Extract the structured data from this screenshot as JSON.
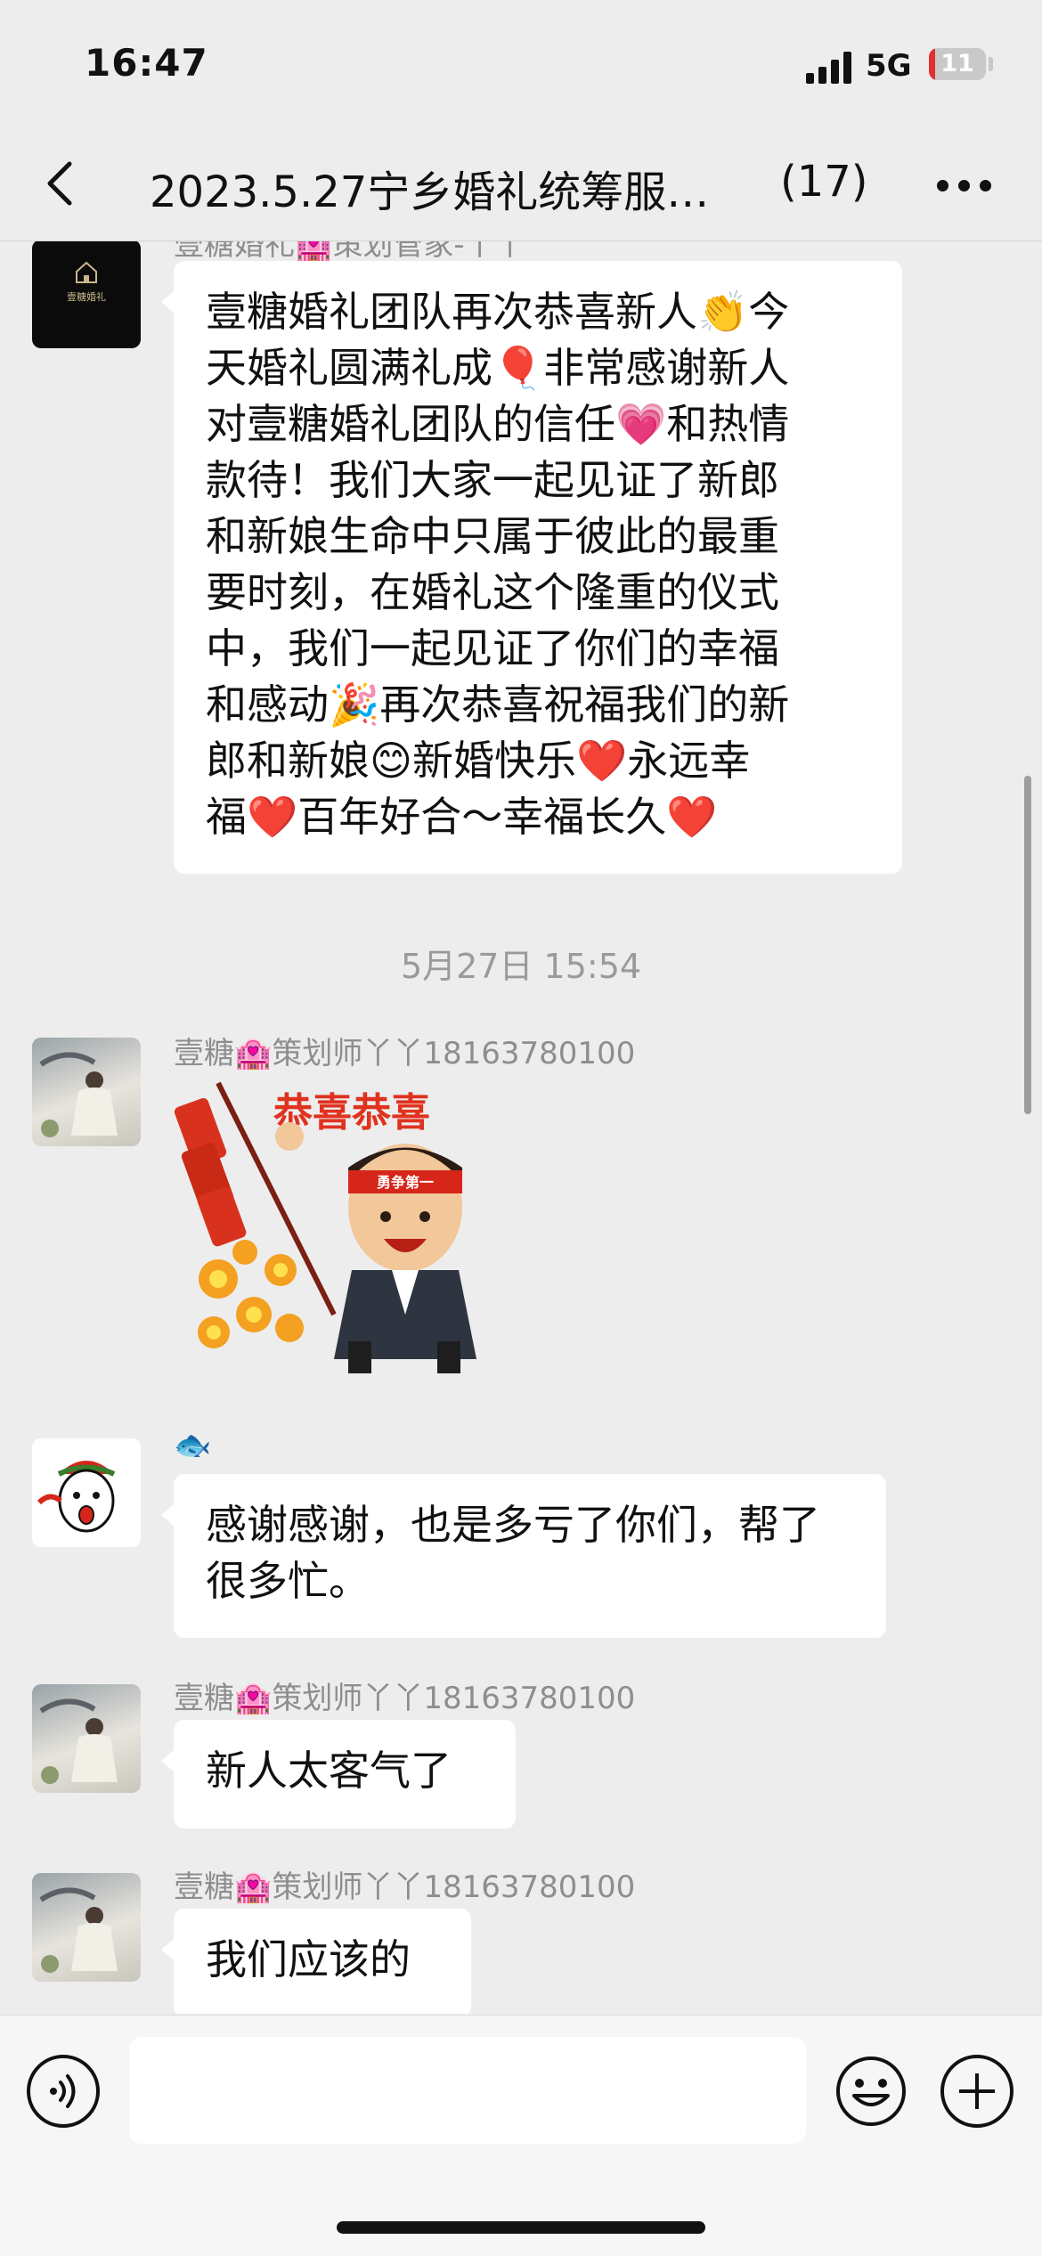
{
  "status_bar": {
    "time": "16:47",
    "network": "5G",
    "battery_level": "11",
    "battery_fraction": 0.11
  },
  "header": {
    "title": "2023.5.27宁乡婚礼统筹服…",
    "member_count": "(17)",
    "back_icon": "chevron-left-icon",
    "more_icon": "more-dots-icon"
  },
  "messages": [
    {
      "sender": "壹糖婚礼🏩策划管家-丫丫",
      "avatar": "brand-logo",
      "avatar_text": "壹糖婚礼",
      "lines": [
        "壹糖婚礼团队再次恭喜新人👏今",
        "天婚礼圆满礼成🎈非常感谢新人",
        "对壹糖婚礼团队的信任💗和热情",
        "款待！我们大家一起见证了新郎",
        "和新娘生命中只属于彼此的最重",
        "要时刻，在婚礼这个隆重的仪式",
        "中，我们一起见证了你们的幸福",
        "和感动🎉再次恭喜祝福我们的新",
        "郎和新娘😊新婚快乐❤️永远幸",
        "福❤️百年好合～幸福长久❤️"
      ]
    },
    {
      "timestamp": "5月27日 15:54"
    },
    {
      "sender": "壹糖🏩策划师丫丫18163780100",
      "sticker_text": "恭喜恭喜",
      "headband_text": "勇争第一"
    },
    {
      "sender": "🐟",
      "text": "感谢感谢，也是多亏了你们，帮了很多忙。"
    },
    {
      "sender": "壹糖🏩策划师丫丫18163780100",
      "text": "新人太客气了"
    },
    {
      "sender": "壹糖🏩策划师丫丫18163780100",
      "text": "我们应该的"
    }
  ],
  "input_bar": {
    "voice_icon": "voice-icon",
    "emoji_icon": "emoji-face-icon",
    "plus_icon": "plus-icon",
    "placeholder": ""
  }
}
